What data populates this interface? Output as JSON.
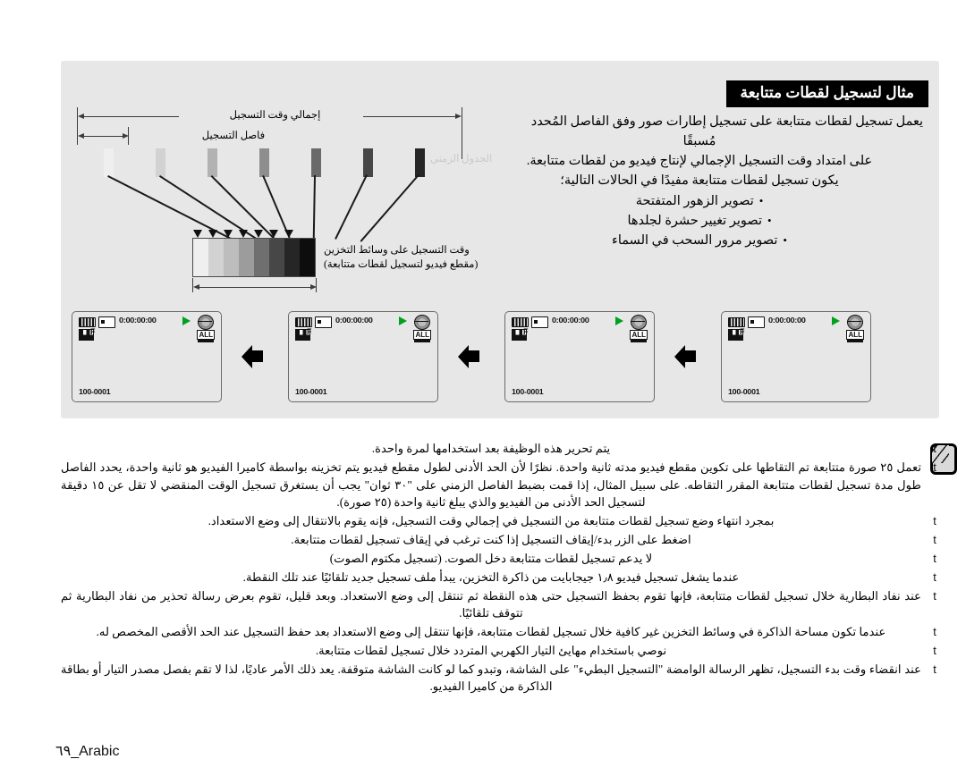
{
  "page": {
    "footer_label": "٦٩_Arabic",
    "language": "Arabic"
  },
  "panel": {
    "banner_title": "مثال لتسجيل لقطات متتابعة",
    "intro": {
      "line1": "يعمل تسجيل لقطات متتابعة على تسجيل إطارات صور وفق الفاصل المُحدد",
      "line2": "مُسبقًا",
      "line3": "على امتداد وقت التسجيل الإجمالي لإنتاج فيديو من لقطات متتابعة.",
      "line4": "يكون تسجيل لقطات متتابعة مفيدًا في الحالات التالية؛",
      "bullets": [
        "تصوير الزهور المتفتحة",
        "تصوير تغيير حشرة لجلدها",
        "تصوير مرور السحب في السماء"
      ]
    },
    "diagram": {
      "label_total": "إجمالي وقت التسجيل",
      "label_interval": "فاصل التسجيل",
      "label_timeline": "الجدول الزمني",
      "caption_line1": "وقت التسجيل على وسائط التخزين",
      "caption_line2": "(مقطع فيديو لتسجيل لقطات متتابعة)"
    },
    "lcd": {
      "timecode": "0:00:00:00",
      "file_number": "100-0001",
      "all_badge": "ALL",
      "icons": {
        "battery": "battery-icon",
        "memory_card": "memory-card-icon",
        "quality": "quality-fine-icon",
        "record": "record-play-icon",
        "globe": "globe-icon"
      }
    }
  },
  "notes": {
    "bullet_glyph": "t",
    "items": [
      {
        "text": "يتم تحرير هذه الوظيفة بعد استخدامها لمرة واحدة."
      },
      {
        "text": "تعمل ٢٥ صورة متتابعة تم التقاطها على تكوين مقطع فيديو مدته ثانية واحدة. نظرًا لأن الحد الأدنى لطول مقطع فيديو يتم تخزينه بواسطة كاميرا الفيديو هو ثانية واحدة، يحدد الفاصل طول مدة تسجيل لقطات متتابعة المقرر التقاطه. على سبيل المثال، إذا قمت بضبط الفاصل الزمني على \"٣٠ ثوان\" يجب أن يستغرق تسجيل الوقت المنقضي لا تقل عن ١٥ دقيقة لتسجيل الحد الأدنى من الفيديو والذي يبلغ ثانية واحدة (٢٥ صورة)."
      },
      {
        "text": "بمجرد انتهاء وضع تسجيل لقطات متتابعة من التسجيل في إجمالي وقت التسجيل، فإنه يقوم بالانتقال إلى وضع الاستعداد."
      },
      {
        "text": "اضغط على الزر بدء/إيقاف التسجيل إذا كنت ترغب في إيقاف تسجيل لقطات متتابعة."
      },
      {
        "text": "لا يدعم تسجيل لقطات متتابعة دخل الصوت. (تسجيل مكتوم الصوت)"
      },
      {
        "text": "عندما يشغل تسجيل فيديو ١٫٨ جيجابايت من ذاكرة التخزين، يبدأ ملف تسجيل جديد تلقائيًا عند تلك النقطة."
      },
      {
        "text": "عند نفاد البطارية خلال تسجيل لقطات متتابعة، فإنها تقوم بحفظ التسجيل حتى هذه النقطة ثم تنتقل إلى وضع الاستعداد. وبعد قليل، تقوم بعرض رسالة تحذير من نفاد البطارية ثم تتوقف تلقائيًا."
      },
      {
        "text": "عندما تكون مساحة الذاكرة في وسائط التخزين غير كافية خلال تسجيل لقطات متتابعة، فإنها تنتقل إلى وضع الاستعداد بعد حفظ التسجيل عند الحد الأقصى المخصص له."
      },
      {
        "text": "نوصي باستخدام مهايئ التيار الكهربي المتردد خلال تسجيل لقطات متتابعة."
      },
      {
        "text": "عند انقضاء وقت بدء التسجيل، تظهر الرسالة الوامضة \"التسجيل البطيء\" على الشاشة، وتبدو كما لو كانت الشاشة متوقفة. يعد ذلك الأمر عاديًا، لذا لا تقم بفصل مصدر التيار أو بطاقة الذاكرة من كاميرا الفيديو."
      }
    ]
  }
}
